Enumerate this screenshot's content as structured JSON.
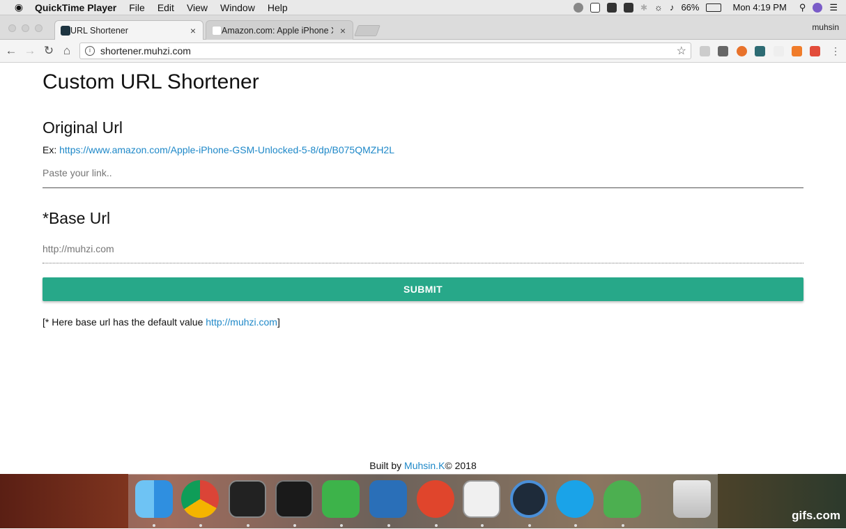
{
  "menubar": {
    "apple": "",
    "app_name": "QuickTime Player",
    "items": [
      "File",
      "Edit",
      "View",
      "Window",
      "Help"
    ],
    "battery": "66%",
    "clock": "Mon 4:19 PM"
  },
  "browser": {
    "tabs": [
      {
        "title": "URL Shortener",
        "close": "×"
      },
      {
        "title": "Amazon.com: Apple iPhone X,",
        "close": "×"
      }
    ],
    "profile": "muhsin",
    "url": "shortener.muhzi.com"
  },
  "page": {
    "title": "Custom URL Shortener",
    "original": {
      "heading": "Original Url",
      "example_prefix": "Ex: ",
      "example_link": "https://www.amazon.com/Apple-iPhone-GSM-Unlocked-5-8/dp/B075QMZH2L",
      "placeholder": "Paste your link.."
    },
    "base": {
      "heading": "*Base Url",
      "placeholder": "http://muhzi.com"
    },
    "submit_label": "SUBMIT",
    "note": {
      "prefix": "[* Here base url has the default value ",
      "link": "http://muhzi.com",
      "suffix": "]"
    },
    "footer": {
      "prefix": "Built by ",
      "author": "Muhsin.K",
      "suffix": "© 2018"
    }
  },
  "dock": {
    "apps": [
      "finder",
      "chrome",
      "terminal",
      "activity-monitor",
      "evernote",
      "vscode",
      "postman",
      "code-editor",
      "quicktime",
      "skype",
      "rocket-app",
      "trash"
    ]
  },
  "watermark": "gifs.com",
  "colors": {
    "accent": "#27a889",
    "link": "#1e88c8"
  }
}
